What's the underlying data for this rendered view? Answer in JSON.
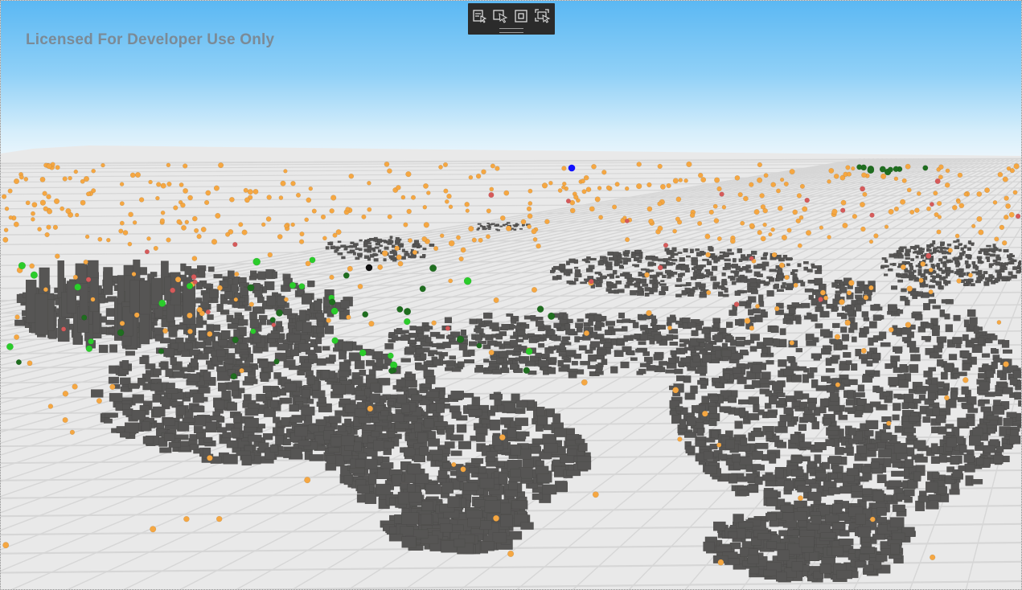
{
  "app": {
    "watermark_text": "Licensed For Developer Use Only"
  },
  "toolbar": {
    "buttons": [
      {
        "name": "focus-mode-button",
        "icon": "focus-mode-icon"
      },
      {
        "name": "select-button",
        "icon": "select-cursor-icon"
      },
      {
        "name": "fullscreen-button",
        "icon": "fullscreen-icon"
      },
      {
        "name": "visual-interactions-button",
        "icon": "visual-interactions-icon"
      }
    ]
  },
  "map": {
    "view": "3D perspective city view",
    "colors": {
      "sky_top": "#5bb8f3",
      "sky_horizon": "#eef7fc",
      "ground": "#e9e9e9",
      "streets": "#d6d6d6",
      "buildings": "#565554",
      "point_orange": "#f5a742",
      "point_red": "#d65a5a",
      "point_green": "#2bcc2b",
      "point_dark_green": "#1f6e1f",
      "point_blue": "#1010ff",
      "point_black": "#101010"
    },
    "marker_categories": [
      "orange",
      "red",
      "green",
      "dark-green",
      "blue",
      "black"
    ]
  }
}
